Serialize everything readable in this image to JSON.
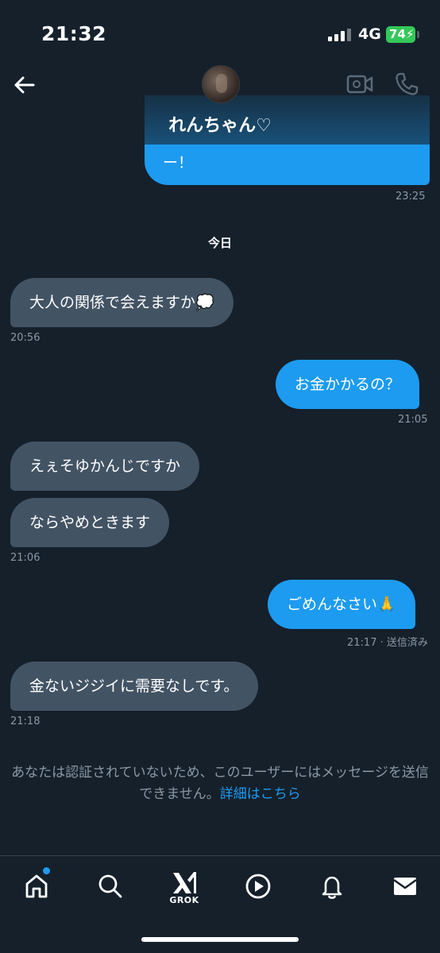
{
  "status_bar": {
    "time": "21:32",
    "network": "4G",
    "battery": "74"
  },
  "header": {
    "contact_name": "れんちゃん♡"
  },
  "thread": {
    "previous_message": {
      "text": "ー！",
      "time": "23:25"
    },
    "day_divider": "今日",
    "messages": [
      {
        "direction": "in",
        "text": "大人の関係で会えますか💭"
      },
      {
        "direction": "in_time",
        "text": "20:56"
      },
      {
        "direction": "out",
        "text": "お金かかるの？"
      },
      {
        "direction": "out_time",
        "text": "21:05"
      },
      {
        "direction": "in",
        "text": "えぇそゆかんじですか"
      },
      {
        "direction": "in",
        "text": "ならやめときます"
      },
      {
        "direction": "in_time",
        "text": "21:06"
      },
      {
        "direction": "out",
        "text": "ごめんなさい🙏"
      },
      {
        "direction": "out_time",
        "text": "21:17 · 送信済み"
      },
      {
        "direction": "in",
        "text": "金ないジジイに需要なしです。"
      },
      {
        "direction": "in_time",
        "text": "21:18"
      }
    ]
  },
  "notice": {
    "text": "あなたは認証されていないため、このユーザーにはメッセージを送信できません。",
    "link": "詳細はこちら"
  },
  "tabbar": {
    "grok_label": "GROK"
  },
  "colors": {
    "background": "#15202b",
    "accent": "#1d9bf0",
    "incoming_bubble": "#425364",
    "meta_text": "#8b98a5"
  }
}
